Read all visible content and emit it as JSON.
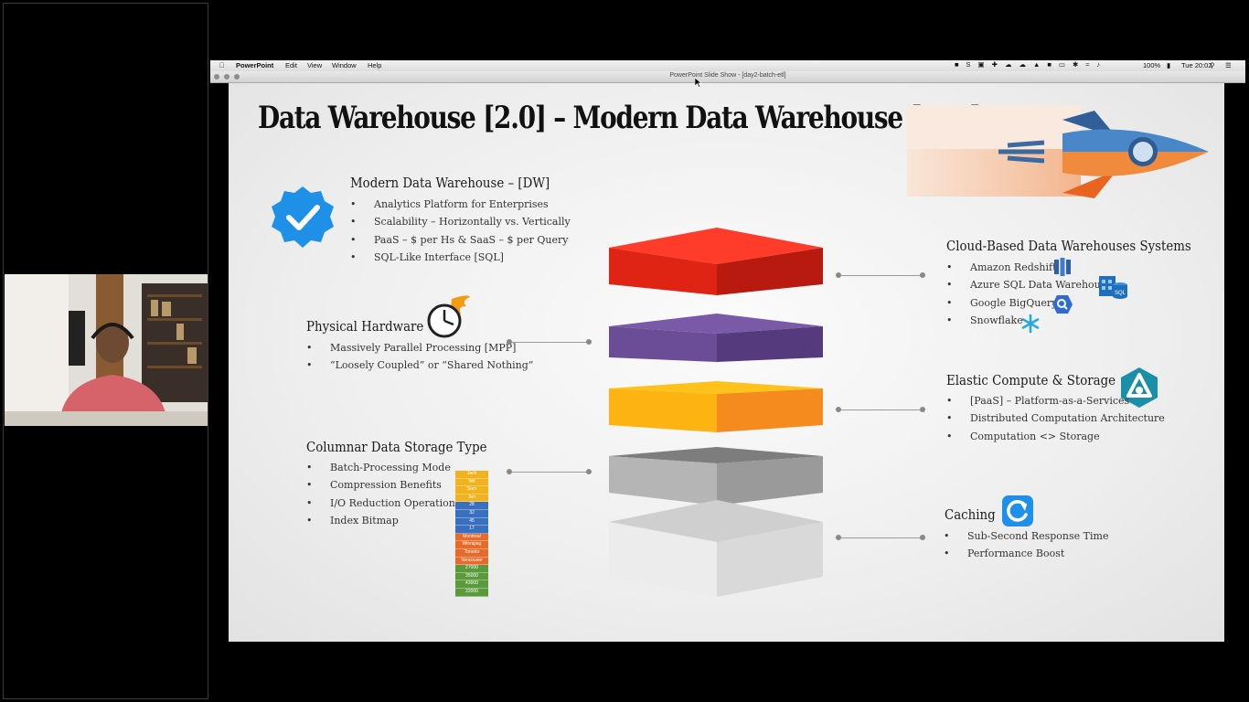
{
  "menubar": {
    "app": "PowerPoint",
    "items": [
      "Edit",
      "View",
      "Window",
      "Help"
    ],
    "battery": "100%",
    "clock": "Tue 20:02"
  },
  "window": {
    "title": "PowerPoint Slide Show - [day2-batch-etl]"
  },
  "slide": {
    "title": "Data Warehouse [2.0] – Modern Data Warehouse [DW]",
    "sections": {
      "modern": {
        "heading": "Modern Data Warehouse – [DW]",
        "bullets": [
          "Analytics Platform for Enterprises",
          "Scalability – Horizontally vs. Vertically",
          "PaaS – $ per Hs & SaaS – $ per Query",
          "SQL-Like Interface [SQL]"
        ]
      },
      "hardware": {
        "heading": "Physical Hardware",
        "bullets": [
          "Massively Parallel Processing [MPP]",
          "“Loosely Coupled” or “Shared Nothing”"
        ]
      },
      "columnar": {
        "heading": "Columnar Data Storage Type",
        "bullets": [
          "Batch-Processing Mode",
          "Compression Benefits",
          "I/O Reduction Operations",
          "Index Bitmap"
        ]
      },
      "cloud": {
        "heading": "Cloud-Based Data Warehouses Systems",
        "bullets": [
          "Amazon Redshift",
          "Azure SQL Data Warehouse",
          "Google BigQuery",
          "Snowflake"
        ]
      },
      "elastic": {
        "heading": "Elastic Compute & Storage",
        "bullets": [
          "[PaaS] – Platform-as-a-Services",
          "Distributed Computation Architecture",
          "Computation <> Storage"
        ]
      },
      "caching": {
        "heading": "Caching",
        "bullets": [
          "Sub-Second Response Time",
          "Performance Boost"
        ]
      }
    },
    "columnar_cells": {
      "names": [
        "Jack",
        "Wil",
        "Sam",
        "Jen"
      ],
      "ages": [
        "28",
        "32",
        "45",
        "17"
      ],
      "cities": [
        "Montreal",
        "Winnipeg",
        "Toronto",
        "Vancouver"
      ],
      "amounts": [
        "27000",
        "35000",
        "43000",
        "22000"
      ]
    },
    "layer_colors": {
      "red": "#d7261c",
      "purple": "#6a4c93",
      "orange": "#f5a623",
      "gray": "#a8a8a8",
      "light": "#dedede"
    },
    "icons": [
      "verified-badge-icon",
      "clock-icon",
      "rocket-icon",
      "amazon-redshift-icon",
      "azure-sql-icon",
      "bigquery-icon",
      "snowflake-icon",
      "azure-synapse-icon",
      "refresh-icon"
    ]
  }
}
